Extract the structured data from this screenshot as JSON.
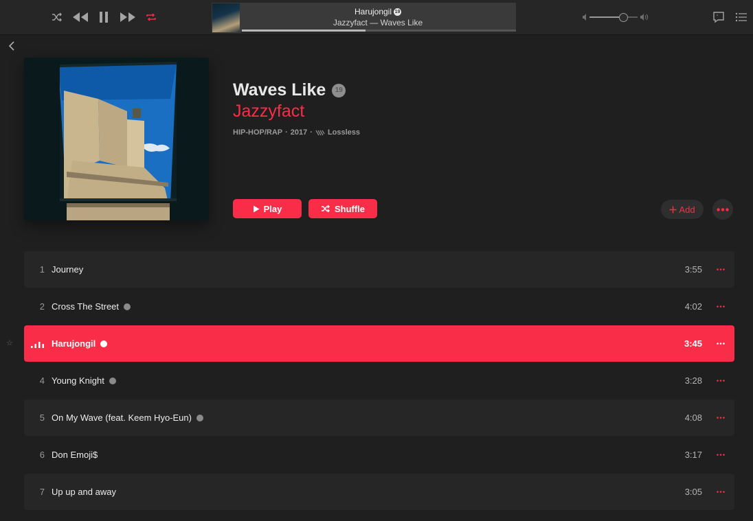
{
  "now_playing": {
    "title": "Harujongil",
    "subtitle": "Jazzyfact — Waves Like",
    "explicit_badge": "19",
    "progress": 0.45
  },
  "volume": {
    "level": 0.7
  },
  "album": {
    "title": "Waves Like",
    "age_badge": "19",
    "artist": "Jazzyfact",
    "genre": "HIP-HOP/RAP",
    "year": "2017",
    "quality": "Lossless"
  },
  "actions": {
    "play_label": "Play",
    "shuffle_label": "Shuffle",
    "add_label": "Add"
  },
  "tracks": [
    {
      "num": "1",
      "title": "Journey",
      "duration": "3:55",
      "explicit": false
    },
    {
      "num": "2",
      "title": "Cross The Street",
      "duration": "4:02",
      "explicit": true
    },
    {
      "num": "3",
      "title": "Harujongil",
      "duration": "3:45",
      "explicit": true,
      "playing": true
    },
    {
      "num": "4",
      "title": "Young Knight",
      "duration": "3:28",
      "explicit": true
    },
    {
      "num": "5",
      "title": "On My Wave (feat. Keem Hyo-Eun)",
      "duration": "4:08",
      "explicit": true
    },
    {
      "num": "6",
      "title": "Don Emoji$",
      "duration": "3:17",
      "explicit": false
    },
    {
      "num": "7",
      "title": "Up up and away",
      "duration": "3:05",
      "explicit": false
    }
  ],
  "icons": {
    "shuffle": "shuffle-icon",
    "rewind": "rewind-icon",
    "pause": "pause-icon",
    "forward": "fast-forward-icon",
    "repeat": "repeat-icon",
    "lyrics": "lyrics-icon",
    "queue": "queue-list-icon"
  },
  "colors": {
    "accent": "#fa2d48",
    "background": "#1f1f1f",
    "toolbar": "#262626"
  }
}
